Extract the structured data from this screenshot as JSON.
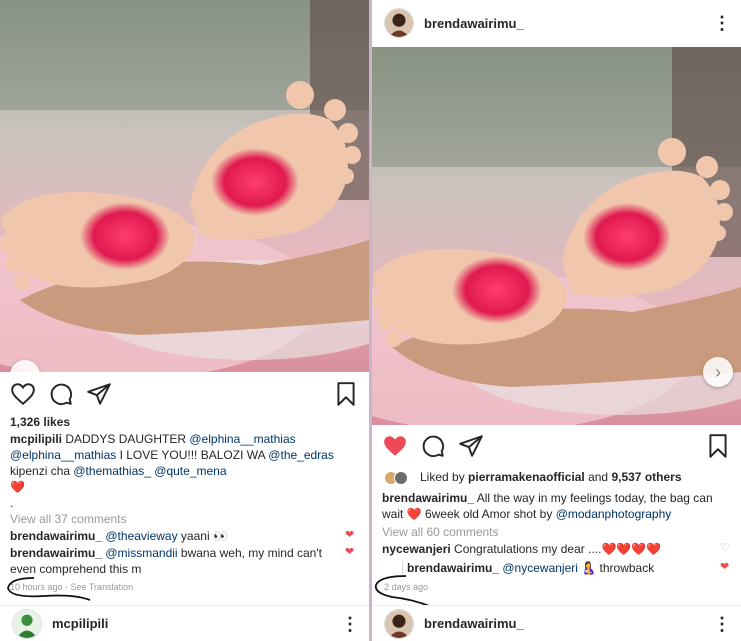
{
  "left": {
    "likes": "1,326 likes",
    "caption_user": "mcpilipili",
    "caption_text_1": " DADDYS DAUGHTER ",
    "mention_1": "@elphina__mathias",
    "mention_2": "@elphina__mathias",
    "caption_text_2": " I LOVE YOU!!! BALOZI WA ",
    "mention_3": "@the_edras",
    "caption_text_3": " kipenzi cha ",
    "mention_4": "@themathias_",
    "mention_5": "@qute_mena",
    "caption_heart": "❤️",
    "caption_dot": ".",
    "view_comments": "View all 37 comments",
    "comments": [
      {
        "user": "brendawairimu_",
        "mention": "@theavieway",
        "text": " yaani 👀"
      },
      {
        "user": "brendawairimu_",
        "mention": "@missmandii",
        "text": " bwana weh, my mind can't even comprehend this m"
      }
    ],
    "time": "10 hours ago",
    "see_translation": "See Translation",
    "next_user": "mcpilipili"
  },
  "right": {
    "header_user": "brendawairimu_",
    "liked_by_prefix": "Liked by ",
    "liked_by_user": "pierramakenaofficial",
    "liked_by_mid": " and ",
    "liked_by_count": "9,537 others",
    "caption_user": "brendawairimu_",
    "caption_text": " All the way in my feelings today, the bag can wait ❤️ 6week old Amor shot by ",
    "caption_mention": "@modanphotography",
    "view_comments": "View all 60 comments",
    "comment_1_user": "nycewanjeri",
    "comment_1_text": " Congratulations my dear ....❤️❤️❤️❤️",
    "reply_user": "brendawairimu_",
    "reply_mention": "@nycewanjeri",
    "reply_text": " 🤱 throwback",
    "time": "2 days ago",
    "next_user": "brendawairimu_"
  },
  "colors": {
    "like_red": "#ed4956",
    "mention_blue": "#003569",
    "muted_gray": "#999999",
    "lipstick": "#e01a4f"
  }
}
